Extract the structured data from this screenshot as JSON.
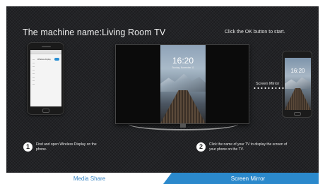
{
  "header": {
    "machine_name": "The machine name:Living Room TV",
    "ok_hint": "Click the OK button to start."
  },
  "left_phone": {
    "setting_label": "Wireless display"
  },
  "tv": {
    "time": "16:20",
    "date": "Sunday, November 11"
  },
  "right_phone": {
    "time": "16:20"
  },
  "mirror": {
    "label": "Screen Mirror"
  },
  "steps": [
    {
      "number": "1",
      "text": "Find and open Wireless Display on the phone."
    },
    {
      "number": "2",
      "text": "Click the name of your TV to display the screen of your phone on the TV."
    }
  ],
  "tabs": [
    {
      "label": "Media Share",
      "selected": false
    },
    {
      "label": "Screen Mirror",
      "selected": true
    }
  ],
  "colors": {
    "accent": "#2b89cc",
    "background": "#222326",
    "inactive_tab_text": "#3a86c4"
  }
}
